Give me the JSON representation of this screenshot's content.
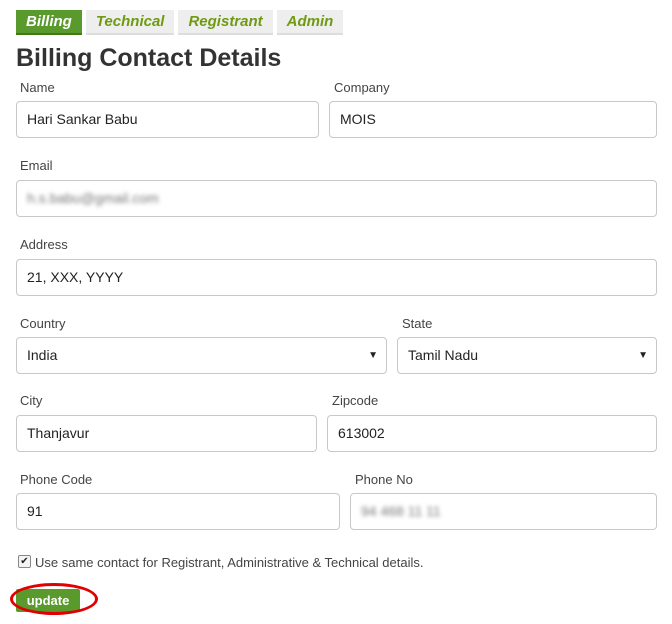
{
  "tabs": [
    {
      "label": "Billing",
      "active": true
    },
    {
      "label": "Technical",
      "active": false
    },
    {
      "label": "Registrant",
      "active": false
    },
    {
      "label": "Admin",
      "active": false
    }
  ],
  "title": "Billing Contact Details",
  "fields": {
    "name": {
      "label": "Name",
      "value": "Hari Sankar Babu"
    },
    "company": {
      "label": "Company",
      "value": "MOIS"
    },
    "email": {
      "label": "Email",
      "value": "h.s.babu@gmail.com"
    },
    "address": {
      "label": "Address",
      "value": "21, XXX, YYYY"
    },
    "country": {
      "label": "Country",
      "value": "India"
    },
    "state": {
      "label": "State",
      "value": "Tamil Nadu"
    },
    "city": {
      "label": "City",
      "value": "Thanjavur"
    },
    "zipcode": {
      "label": "Zipcode",
      "value": "613002"
    },
    "phone_code": {
      "label": "Phone Code",
      "value": "91"
    },
    "phone_no": {
      "label": "Phone No",
      "value": "94 468 11 11"
    }
  },
  "same_contact": {
    "checked": true,
    "label": "Use same contact for Registrant, Administrative & Technical details."
  },
  "update_button": "update",
  "colors": {
    "accent": "#5a9a2d",
    "tab_text": "#6f9a12",
    "highlight": "#e00000"
  }
}
